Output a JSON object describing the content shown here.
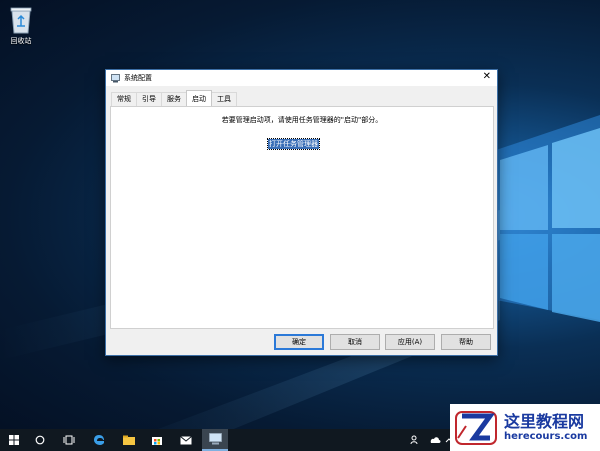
{
  "desktop": {
    "recycle_bin_label": "回收站"
  },
  "dialog": {
    "title": "系统配置",
    "close_glyph": "✕",
    "tabs": [
      {
        "label": "常规",
        "active": false
      },
      {
        "label": "引导",
        "active": false
      },
      {
        "label": "服务",
        "active": false
      },
      {
        "label": "启动",
        "active": true
      },
      {
        "label": "工具",
        "active": false
      }
    ],
    "startup": {
      "info_text": "若要管理启动项，请使用任务管理器的\"启动\"部分。",
      "link_text": "打开任务管理器"
    },
    "buttons": {
      "ok": "确定",
      "cancel": "取消",
      "apply": "应用(A)",
      "help": "帮助"
    }
  },
  "taskbar": {
    "icons": [
      "windows-start-icon",
      "search-circle-icon",
      "task-view-icon",
      "edge-icon",
      "file-explorer-icon",
      "store-icon",
      "mail-icon",
      "system-config-icon"
    ],
    "tray_icons": [
      "people-icon",
      "onedrive-icon",
      "chevron-up-icon"
    ]
  },
  "watermark": {
    "line1": "这里教程网",
    "line2": "herecours.com"
  },
  "colors": {
    "accent": "#2b79d8",
    "taskbar": "#101820",
    "selection": "#3a6fb7"
  }
}
